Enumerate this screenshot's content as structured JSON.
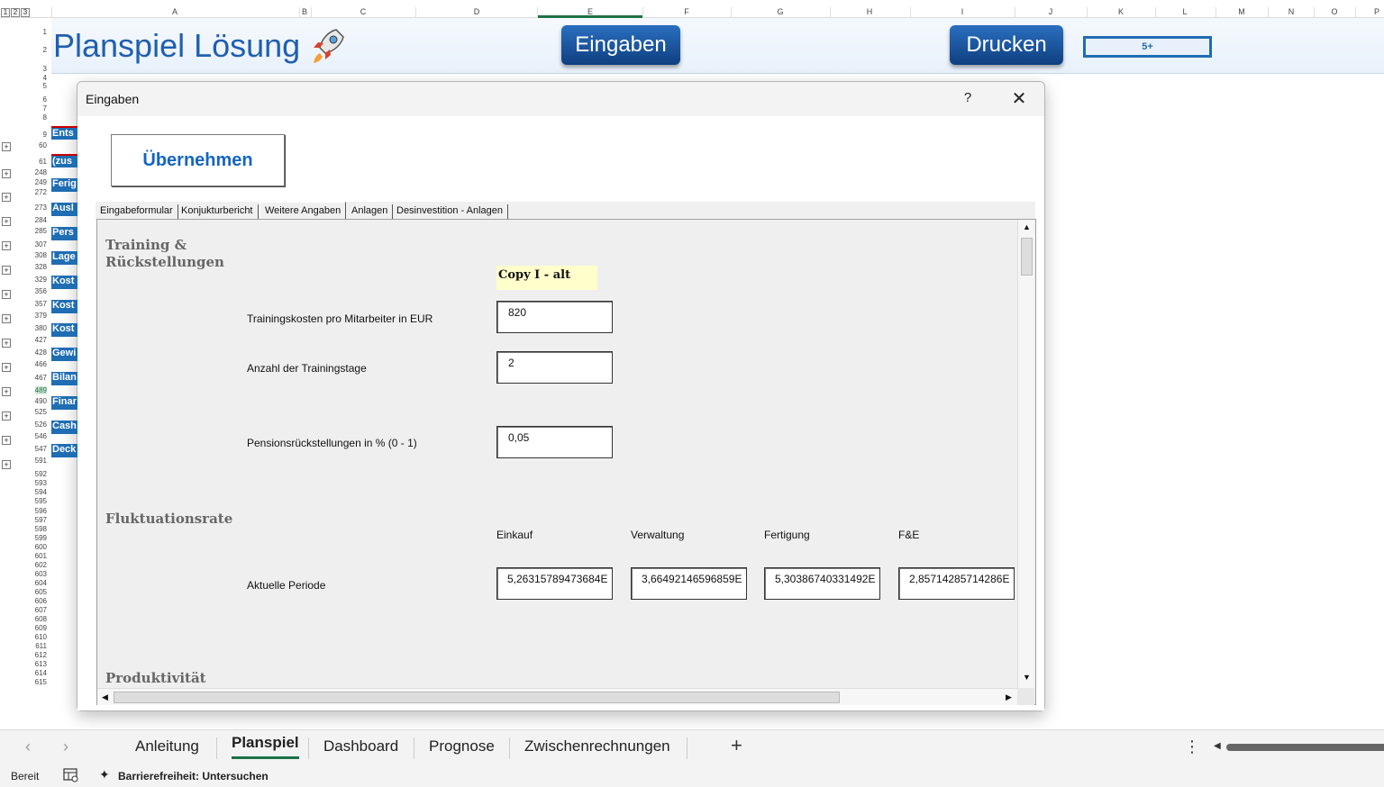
{
  "sheet": {
    "outline_levels": [
      "1",
      "2",
      "3"
    ],
    "columns": [
      "A",
      "B",
      "C",
      "D",
      "E",
      "F",
      "G",
      "H",
      "I",
      "J",
      "K",
      "L",
      "M",
      "N",
      "O",
      "P"
    ],
    "rows": [
      "1",
      "2",
      "3",
      "4",
      "5",
      "6",
      "7",
      "8",
      "9",
      "60",
      "61",
      "248",
      "249",
      "272",
      "273",
      "284",
      "285",
      "307",
      "308",
      "328",
      "329",
      "356",
      "357",
      "379",
      "380",
      "427",
      "428",
      "466",
      "467",
      "489",
      "490",
      "525",
      "526",
      "546",
      "547",
      "591",
      "592",
      "593",
      "594",
      "595",
      "596",
      "597",
      "598",
      "599",
      "600",
      "601",
      "602",
      "603",
      "604",
      "605",
      "606",
      "607",
      "608",
      "609",
      "610",
      "611",
      "612",
      "613",
      "614",
      "615"
    ],
    "side_cells": [
      "Ents",
      "(zus",
      "Ferig",
      "Ausl",
      "Pers",
      "Lage",
      "Kost",
      "Kost",
      "Kost",
      "Gewi",
      "Bilan",
      "Finar",
      "Cash",
      "Deck"
    ]
  },
  "banner": {
    "title": "Planspiel Lösung",
    "eingaben_button": "Eingaben",
    "drucken_button": "Drucken",
    "level_value": "5+"
  },
  "dialog": {
    "title": "Eingaben",
    "help_label": "?",
    "close_label": "✕",
    "apply_button": "Übernehmen",
    "tabs": [
      "Eingabeformular",
      "Konjukturbericht",
      "Weitere Angaben",
      "Anlagen",
      "Desinvestition - Anlagen"
    ],
    "active_tab": "Weitere Angaben",
    "training_section": {
      "title_line1": "Training &",
      "title_line2": "Rückstellungen",
      "copy_badge": "Copy I -  alt",
      "training_cost_label": "Trainingskosten pro Mitarbeiter in EUR",
      "training_cost_value": "820",
      "training_days_label": "Anzahl der Trainingstage",
      "training_days_value": "2",
      "pension_label": "Pensionsrückstellungen in % (0 - 1)",
      "pension_value": "0,05"
    },
    "fluctuation_section": {
      "title": "Fluktuationsrate",
      "columns": [
        "Einkauf",
        "Verwaltung",
        "Fertigung",
        "F&E"
      ],
      "row_label": "Aktuelle Periode",
      "values": [
        "5,26315789473684E",
        "3,66492146596859E",
        "5,30386740331492E",
        "2,85714285714286E"
      ]
    },
    "productivity_section": {
      "title": "Produktivität"
    }
  },
  "sheet_tabs": {
    "tabs": [
      "Anleitung",
      "Planspiel",
      "Dashboard",
      "Prognose",
      "Zwischenrechnungen"
    ],
    "active": "Planspiel",
    "add_label": "+",
    "more_label": "⋮"
  },
  "status_bar": {
    "ready": "Bereit",
    "accessibility": "Barrierefreiheit: Untersuchen"
  }
}
